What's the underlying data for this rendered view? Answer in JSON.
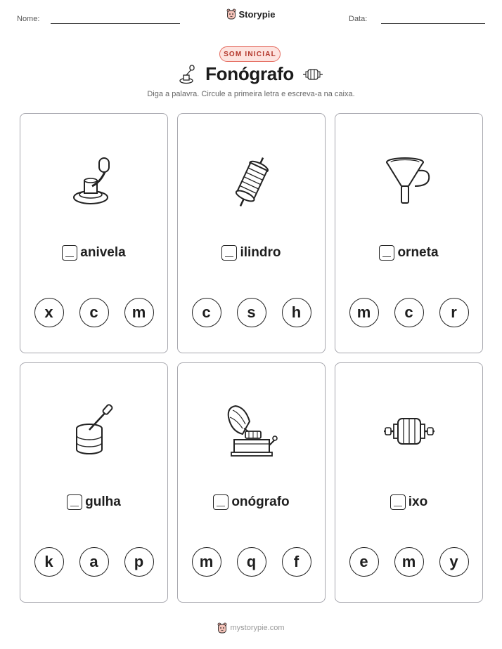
{
  "header": {
    "name_label": "Nome:",
    "date_label": "Data:",
    "brand": "Storypie"
  },
  "badge": "SOM INICIAL",
  "title": "Fonógrafo",
  "subtitle": "Diga a palavra. Circule a primeira letra e escreva-a na caixa.",
  "cards": [
    {
      "image": "crank-icon",
      "word": "anivela",
      "options": [
        "x",
        "c",
        "m"
      ]
    },
    {
      "image": "spool-icon",
      "word": "ilindro",
      "options": [
        "c",
        "s",
        "h"
      ]
    },
    {
      "image": "funnel-horn-icon",
      "word": "orneta",
      "options": [
        "m",
        "c",
        "r"
      ]
    },
    {
      "image": "needle-record-icon",
      "word": "gulha",
      "options": [
        "k",
        "a",
        "p"
      ]
    },
    {
      "image": "phonograph-icon",
      "word": "onógrafo",
      "options": [
        "m",
        "q",
        "f"
      ]
    },
    {
      "image": "axle-icon",
      "word": "ixo",
      "options": [
        "e",
        "m",
        "y"
      ]
    }
  ],
  "footer": "mystorypie.com"
}
